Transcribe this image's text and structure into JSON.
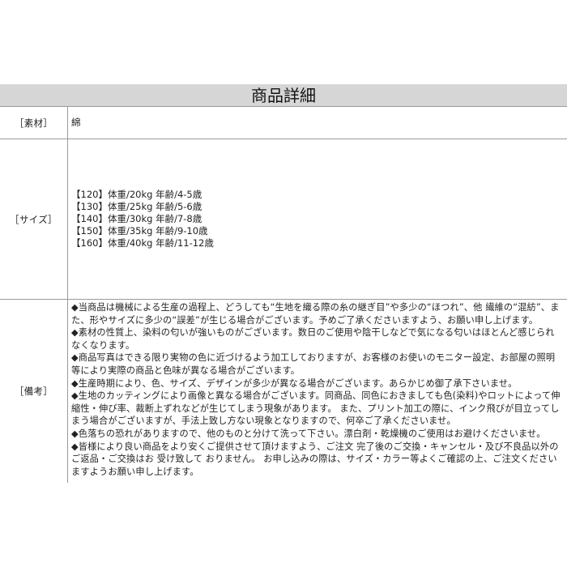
{
  "title": "商品詳細",
  "rows": {
    "material": {
      "label": "［素材］",
      "value": "綿"
    },
    "size": {
      "label": "［サイズ］",
      "items": [
        "【120】体重/20kg 年齢/4-5歳",
        "【130】体重/25kg 年齢/5-6歳",
        "【140】体重/30kg 年齢/7-8歳",
        "【150】体重/35kg 年齢/9-10歳",
        "【160】体重/40kg 年齢/11-12歳"
      ]
    },
    "notes": {
      "label": "［備考］",
      "items": [
        "◆当商品は機械による生産の過程上、どうしても“生地を織る際の糸の継ぎ目”や多少の“ほつれ”、他 繊維の“混紡”、また、形やサイズに多少の“誤差”が生じる場合がございます。予めご了承くださいますよう、お願い申し上げます。",
        "◆素材の性質上、染料の匂いが強いものがございます。数日のご使用や陰干しなどで気になる匂いはほとんど感じられなくなります。",
        "◆商品写真はできる限り実物の色に近づけるよう加工しておりますが、お客様のお使いのモニター設定、お部屋の照明等により実際の商品と色味が異なる場合がございます。",
        "◆生産時期により、色、サイズ、デザインが多少が異なる場合がございます。あらかじめ御了承下さいませ。",
        "◆生地のカッティングにより画像と異なる場合がございます。同商品、同色におきましても色(染料)やロットによって伸縮性・伸び率、裁断上ずれなどが生じてしまう現象があります。 また、プリント加工の際に、インク飛びが目立ってしまう場合がございますが、手法上致し方ない現象となりますので、何卒ご了承くださいませ。",
        "◆色落ちの恐れがありますので、他のものと分けて洗って下さい。漂白剤・乾燥機のご使用はお避けくださいませ。",
        "◆皆様により良い商品をより安くご提供させて頂けますよう、ご注文 完了後のご交換・キャンセル・及び不良品以外のご返品・ご交換はお 受け致して おりません。 お申し込みの際は、サイズ・カラー等よくご確認の上、ご注文くださいますようお願い申し上げます。"
      ]
    }
  }
}
